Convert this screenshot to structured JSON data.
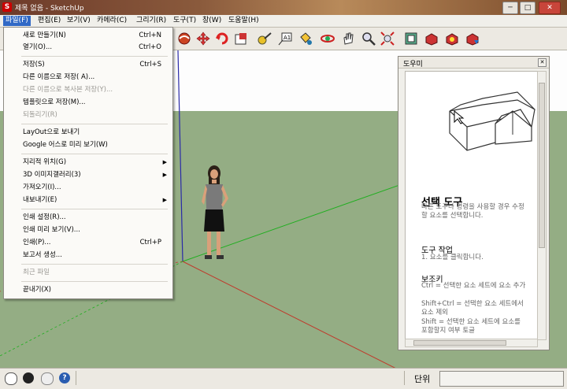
{
  "window": {
    "title": "제목 없음 - SketchUp",
    "buttons": {
      "minimize": "─",
      "maximize": "□",
      "close": "✕"
    }
  },
  "menubar": [
    {
      "label": "파일(F)",
      "active": true
    },
    {
      "label": "편집(E)"
    },
    {
      "label": "보기(V)"
    },
    {
      "label": "카메라(C)"
    },
    {
      "label": "그리기(R)"
    },
    {
      "label": "도구(T)"
    },
    {
      "label": "창(W)"
    },
    {
      "label": "도움말(H)"
    }
  ],
  "file_menu": {
    "items": [
      {
        "label": "새로 만들기(N)",
        "shortcut": "Ctrl+N"
      },
      {
        "label": "열기(O)...",
        "shortcut": "Ctrl+O"
      },
      {
        "label": "저장(S)",
        "shortcut": "Ctrl+S"
      },
      {
        "label": "다른 이름으로 저장( A)..."
      },
      {
        "label": "다른 이름으로 복사본 저장(Y)...",
        "disabled": true
      },
      {
        "label": "템플릿으로 저장(M)..."
      },
      {
        "label": "되돌리기(R)",
        "disabled": true
      },
      {
        "label": "LayOut으로 보내기"
      },
      {
        "label": "Google 어스로 미리 보기(W)"
      },
      {
        "label": "지리적 위치(G)",
        "submenu": true
      },
      {
        "label": "3D 이미지갤러리(3)",
        "submenu": true
      },
      {
        "label": "가져오기(I)..."
      },
      {
        "label": "내보내기(E)",
        "submenu": true
      },
      {
        "label": "인쇄 설정(R)..."
      },
      {
        "label": "인쇄 미리 보기(V)..."
      },
      {
        "label": "인쇄(P)...",
        "shortcut": "Ctrl+P"
      },
      {
        "label": "보고서 생성..."
      },
      {
        "label": "최근 파일",
        "disabled": true
      },
      {
        "label": "끝내기(X)"
      }
    ]
  },
  "toolbar": {
    "icons": [
      "orbit-icon",
      "pan-icon",
      "zoom-icon",
      "zoom-extents-icon",
      "rotate-icon",
      "move-icon",
      "follow-me-icon",
      "offset-icon",
      "tape-measure-icon",
      "text-icon",
      "paint-bucket-icon",
      "section-icon",
      "walk-icon",
      "look-around-icon",
      "zoom-window-icon",
      "position-camera-icon",
      "components-icon",
      "warehouse-icon",
      "extension-icon",
      "share-icon"
    ]
  },
  "instructor": {
    "header": "도우미",
    "title": "선택 도구",
    "description": "다른 도구나 명령을 사용할 경우 수정할 요소를 선택합니다.",
    "ops_title": "도구 작업",
    "ops": [
      "1.  요소를 클릭합니다."
    ],
    "keys_title": "보조키",
    "keys": [
      "Ctrl = 선택한 요소 세트에 요소 추가",
      "Shift+Ctrl = 선택한 요소 세트에서 요소 제외",
      "Shift = 선택한 요소 세트에 요소를 포함할지 여부 토글"
    ]
  },
  "statusbar": {
    "units_label": "단위",
    "icons": [
      "geo-location-icon",
      "credits-icon",
      "user-icon",
      "help-icon"
    ]
  },
  "colors": {
    "sky": "#fdfdfd",
    "ground": "#94ad84",
    "axis_red": "#c0392b",
    "axis_green": "#1fae1f",
    "axis_blue": "#2a2aa8",
    "menu_highlight": "#3169c6"
  }
}
